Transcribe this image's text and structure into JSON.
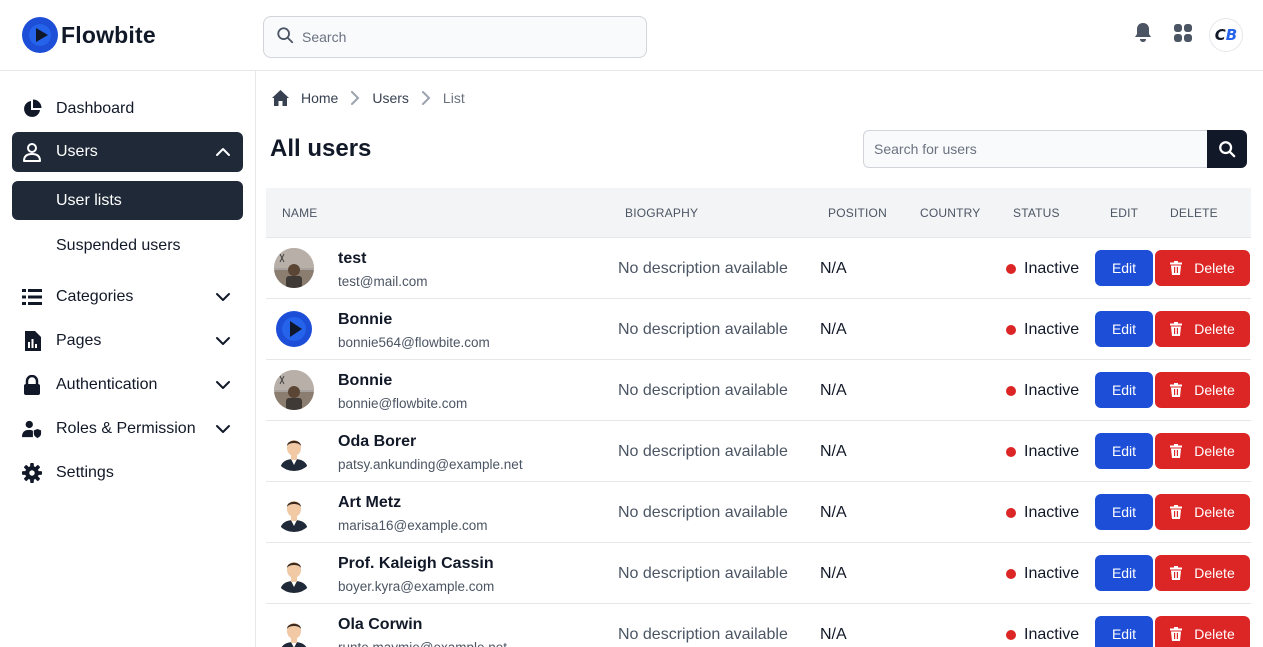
{
  "brand": {
    "name": "Flowbite"
  },
  "topbar": {
    "search_placeholder": "Search",
    "notification_icon": "bell-icon",
    "apps_icon": "grid-icon",
    "avatar_initials_c": "C",
    "avatar_initials_b": "B"
  },
  "sidebar": {
    "dashboard": "Dashboard",
    "users": "Users",
    "user_lists": "User lists",
    "suspended_users": "Suspended users",
    "categories": "Categories",
    "pages": "Pages",
    "authentication": "Authentication",
    "roles": "Roles & Permission",
    "settings": "Settings"
  },
  "breadcrumb": {
    "home": "Home",
    "users": "Users",
    "current": "List"
  },
  "page_title": "All users",
  "user_search": {
    "placeholder": "Search for users"
  },
  "table": {
    "headers": {
      "name": "Name",
      "biography": "Biography",
      "position": "Position",
      "country": "Country",
      "status": "Status",
      "edit": "Edit",
      "delete": "Delete"
    },
    "edit_label": "Edit",
    "delete_label": "Delete",
    "rows": [
      {
        "name": "test",
        "email": "test@mail.com",
        "biography": "No description available",
        "position": "N/A",
        "country": "",
        "status": "Inactive",
        "avatar": "photo"
      },
      {
        "name": "Bonnie",
        "email": "bonnie564@flowbite.com",
        "biography": "No description available",
        "position": "N/A",
        "country": "",
        "status": "Inactive",
        "avatar": "logo"
      },
      {
        "name": "Bonnie",
        "email": "bonnie@flowbite.com",
        "biography": "No description available",
        "position": "N/A",
        "country": "",
        "status": "Inactive",
        "avatar": "photo"
      },
      {
        "name": "Oda Borer",
        "email": "patsy.ankunding@example.net",
        "biography": "No description available",
        "position": "N/A",
        "country": "",
        "status": "Inactive",
        "avatar": "person"
      },
      {
        "name": "Art Metz",
        "email": "marisa16@example.com",
        "biography": "No description available",
        "position": "N/A",
        "country": "",
        "status": "Inactive",
        "avatar": "person"
      },
      {
        "name": "Prof. Kaleigh Cassin",
        "email": "boyer.kyra@example.com",
        "biography": "No description available",
        "position": "N/A",
        "country": "",
        "status": "Inactive",
        "avatar": "person"
      },
      {
        "name": "Ola Corwin",
        "email": "runte.maymie@example.net",
        "biography": "No description available",
        "position": "N/A",
        "country": "",
        "status": "Inactive",
        "avatar": "person"
      }
    ]
  },
  "colors": {
    "primary": "#1d4ed8",
    "danger": "#dc2626",
    "dark": "#1f2937"
  }
}
